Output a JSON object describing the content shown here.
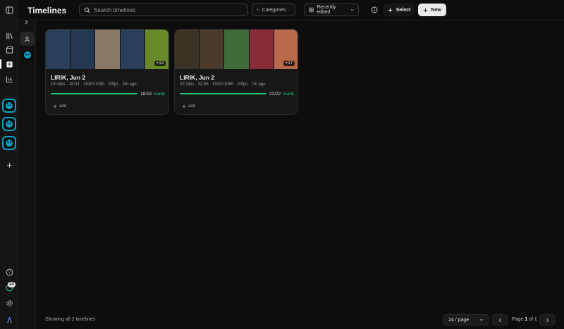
{
  "header": {
    "title": "Timelines",
    "count": "2",
    "search_placeholder": "Search timelines",
    "categories_label": "Categories",
    "sort_label": "Recently edited",
    "select_label": "Select",
    "new_label": "New"
  },
  "rail": {
    "badge": "24",
    "icons": [
      "sidebar-toggle-icon",
      "library-icon",
      "clapperboard-icon",
      "timeline-icon",
      "chart-icon",
      "help-icon",
      "status-icon",
      "settings-icon",
      "logo-icon"
    ]
  },
  "cards": [
    {
      "name": "LIRIK, Jun 2",
      "meta": "18 clips · 18:34 · 1920×1080 · 30fps · 3m ago",
      "progress_ratio": "18/18",
      "progress_fraction": 1.0,
      "status": "ready",
      "more": "+13",
      "add": "add",
      "thumb_colors": [
        "#2a3f5a",
        "#24384f",
        "#8a7a63",
        "#2a3f5a",
        "#6a8a2a"
      ]
    },
    {
      "name": "LIRIK, Jun 2",
      "meta": "22 clips · 32:35 · 1920×1080 · 30fps · 7m ago",
      "progress_ratio": "22/22",
      "progress_fraction": 1.0,
      "status": "ready",
      "more": "+17",
      "add": "add",
      "thumb_colors": [
        "#3a3326",
        "#4a3a2e",
        "#3f6b3a",
        "#8a2b3a",
        "#b86a4a"
      ]
    }
  ],
  "footer": {
    "showing": "Showing all 2 timelines",
    "per_page": "24 / page",
    "page_prefix": "Page ",
    "page_current": "1",
    "page_of": " of 1"
  },
  "colors": {
    "accent_green": "#22c277",
    "avatar_border": "#0aa3c8",
    "background": "#0d0d0d"
  }
}
